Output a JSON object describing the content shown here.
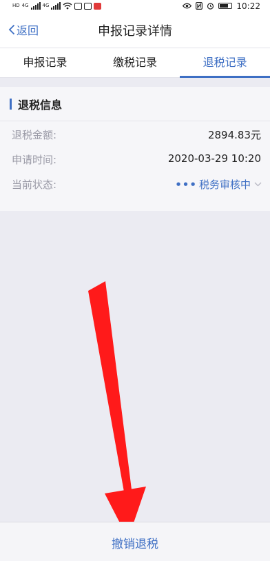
{
  "status_bar": {
    "time": "10:22",
    "network_labels": [
      "HD",
      "4G",
      "4G"
    ],
    "icons": [
      "signal-icon",
      "wifi-icon",
      "eye-icon",
      "nfc-icon",
      "alarm-icon",
      "battery-icon"
    ]
  },
  "nav": {
    "back_label": "返回",
    "title": "申报记录详情"
  },
  "tabs": [
    {
      "label": "申报记录",
      "active": false
    },
    {
      "label": "缴税记录",
      "active": false
    },
    {
      "label": "退税记录",
      "active": true
    }
  ],
  "refund": {
    "section_title": "退税信息",
    "rows": [
      {
        "label": "退税金额:",
        "value": "2894.83元"
      },
      {
        "label": "申请时间:",
        "value": "2020-03-29 10:20"
      },
      {
        "label": "当前状态:",
        "value": "税务审核中"
      }
    ]
  },
  "bottom": {
    "cancel_label": "撤销退税"
  },
  "colors": {
    "accent": "#3e6fc4",
    "annotation_arrow": "#ff1a1a"
  }
}
